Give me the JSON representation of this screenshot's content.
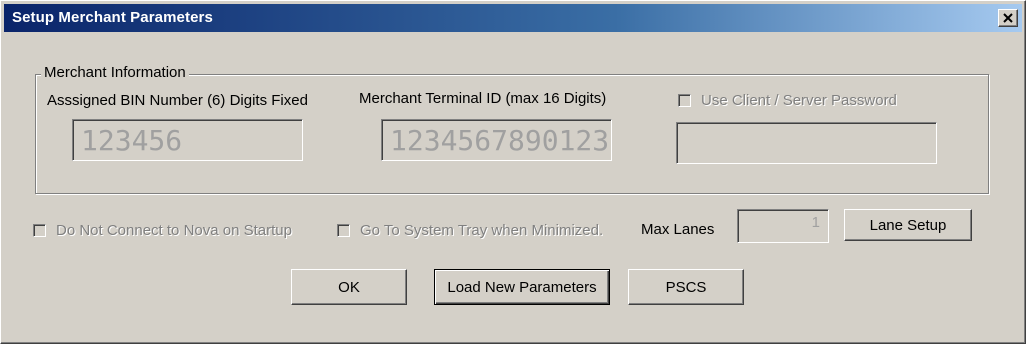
{
  "window": {
    "title": "Setup Merchant Parameters"
  },
  "merchant_info": {
    "legend": "Merchant Information",
    "bin_label": "Asssigned BIN Number (6) Digits Fixed",
    "bin_value": "123456",
    "terminal_label": "Merchant Terminal ID (max 16 Digits)",
    "terminal_value": "1234567890123",
    "password_checkbox_label": "Use Client / Server Password",
    "password_value": ""
  },
  "options": {
    "no_connect_label": "Do Not Connect to Nova on Startup",
    "system_tray_label": "Go To System Tray when Minimized.",
    "max_lanes_label": "Max Lanes",
    "max_lanes_value": "1",
    "lane_setup_button": "Lane Setup"
  },
  "buttons": {
    "ok": "OK",
    "load_new_parameters": "Load New Parameters",
    "pscs": "PSCS"
  },
  "icons": {
    "close": "close-icon"
  },
  "colors": {
    "titlebar_start": "#0a246a",
    "titlebar_end": "#a6caf0",
    "dialog_bg": "#d4d0c8"
  }
}
